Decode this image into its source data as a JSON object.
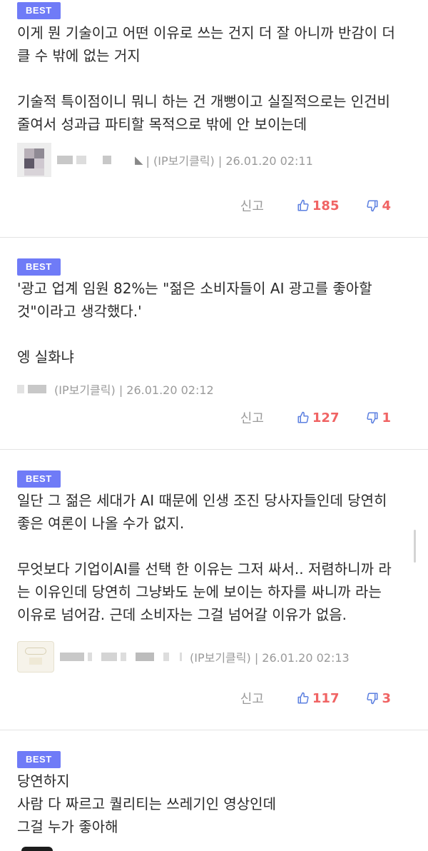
{
  "comments": [
    {
      "badge": "BEST",
      "text": "이게 뭔 기술이고 어떤 이유로 쓰는 건지 더 잘 아니까 반감이 더\n클 수 밖에 없는 거지\n\n기술적 특이점이니 뭐니 하는 건 개뻥이고 실질적으로는 인건비\n줄여서 성과급 파티할 목적으로 밖에 안 보이는데",
      "meta": "| (IP보기클릭) | 26.01.20 02:11",
      "report": "신고",
      "up": "185",
      "down": "4"
    },
    {
      "badge": "BEST",
      "text": "'광고 업계 임원 82%는 \"젊은 소비자들이 AI 광고를 좋아할\n것\"이라고 생각했다.'\n\n엥 실화냐",
      "meta": "(IP보기클릭) | 26.01.20 02:12",
      "report": "신고",
      "up": "127",
      "down": "1"
    },
    {
      "badge": "BEST",
      "text": "일단 그 젊은 세대가 AI 때문에 인생 조진 당사자들인데 당연히\n좋은 여론이 나올 수가 없지.\n\n무엇보다 기업이AI를 선택 한 이유는 그저 싸서.. 저렴하니까 라\n는 이유인데 당연히 그냥봐도 눈에 보이는 하자를 싸니까 라는\n이유로 넘어감. 근데 소비자는 그걸 넘어갈 이유가 없음.",
      "meta": "(IP보기클릭) | 26.01.20 02:13",
      "report": "신고",
      "up": "117",
      "down": "3"
    },
    {
      "badge": "BEST",
      "text": "당연하지\n사람 다 짜르고 퀄리티는 쓰레기인 영상인데\n그걸 누가 좋아해"
    }
  ],
  "colors": {
    "badge": "#6f7bf7",
    "vote_up": "#f06464",
    "vote_down": "#f06464",
    "meta_gray": "#9a9a9a"
  },
  "icons": {
    "up": "thumbs-up-icon",
    "down": "thumbs-down-icon"
  }
}
